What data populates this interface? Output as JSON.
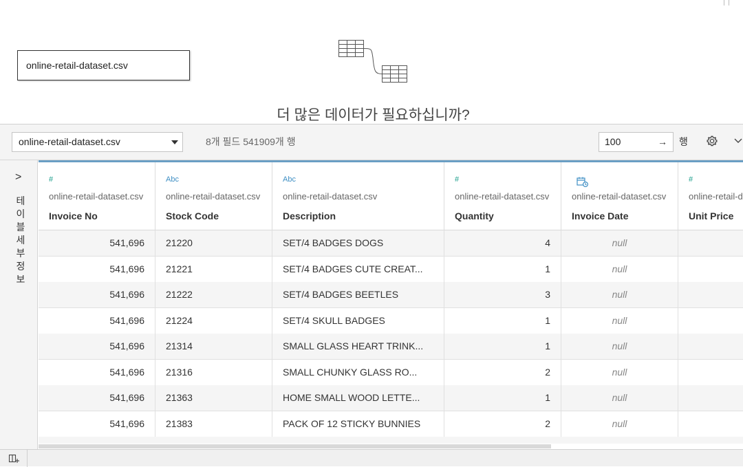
{
  "canvas": {
    "source_name": "online-retail-dataset.csv",
    "more_data_prompt": "더 많은 데이터가 필요하십니까?"
  },
  "toolbar": {
    "table_select_value": "online-retail-dataset.csv",
    "field_count": "8개 필드 541909개 행",
    "rows_value": "100",
    "rows_label": "행"
  },
  "sidebar": {
    "expand_glyph": ">",
    "label": "테이블 세부 정보"
  },
  "columns": [
    {
      "type": "#",
      "type_name": "number",
      "source": "online-retail-dataset.csv",
      "name": "Invoice No"
    },
    {
      "type": "Abc",
      "type_name": "string",
      "source": "online-retail-dataset.csv",
      "name": "Stock Code"
    },
    {
      "type": "Abc",
      "type_name": "string",
      "source": "online-retail-dataset.csv",
      "name": "Description"
    },
    {
      "type": "#",
      "type_name": "number",
      "source": "online-retail-dataset.csv",
      "name": "Quantity"
    },
    {
      "type": "datetime",
      "type_name": "datetime",
      "source": "online-retail-dataset.csv",
      "name": "Invoice Date"
    },
    {
      "type": "#",
      "type_name": "number",
      "source": "online-retail-d",
      "name": "Unit Price"
    }
  ],
  "rows": [
    {
      "invoice_no": "541,696",
      "stock_code": "21220",
      "description": "SET/4 BADGES DOGS",
      "quantity": "4",
      "invoice_date": "null"
    },
    {
      "invoice_no": "541,696",
      "stock_code": "21221",
      "description": "SET/4 BADGES CUTE CREAT...",
      "quantity": "1",
      "invoice_date": "null"
    },
    {
      "invoice_no": "541,696",
      "stock_code": "21222",
      "description": "SET/4 BADGES BEETLES",
      "quantity": "3",
      "invoice_date": "null"
    },
    {
      "invoice_no": "541,696",
      "stock_code": "21224",
      "description": "SET/4 SKULL BADGES",
      "quantity": "1",
      "invoice_date": "null"
    },
    {
      "invoice_no": "541,696",
      "stock_code": "21314",
      "description": "SMALL GLASS HEART TRINK...",
      "quantity": "1",
      "invoice_date": "null"
    },
    {
      "invoice_no": "541,696",
      "stock_code": "21316",
      "description": "SMALL CHUNKY GLASS RO...",
      "quantity": "2",
      "invoice_date": "null"
    },
    {
      "invoice_no": "541,696",
      "stock_code": "21363",
      "description": "HOME SMALL WOOD LETTE...",
      "quantity": "1",
      "invoice_date": "null"
    },
    {
      "invoice_no": "541,696",
      "stock_code": "21383",
      "description": "PACK OF 12 STICKY BUNNIES",
      "quantity": "2",
      "invoice_date": "null"
    }
  ],
  "icons": {
    "number_type": "hash-icon",
    "string_type": "abc-icon",
    "date_type": "calendar-clock-icon",
    "settings": "gear-icon",
    "more": "chevron-down-icon",
    "rows_apply": "arrow-right-icon",
    "tab": "new-sheet-icon"
  },
  "colors": {
    "accent_border": "#6a9ec4",
    "number_icon": "#1a9e8b",
    "string_icon": "#3f8fc4"
  }
}
